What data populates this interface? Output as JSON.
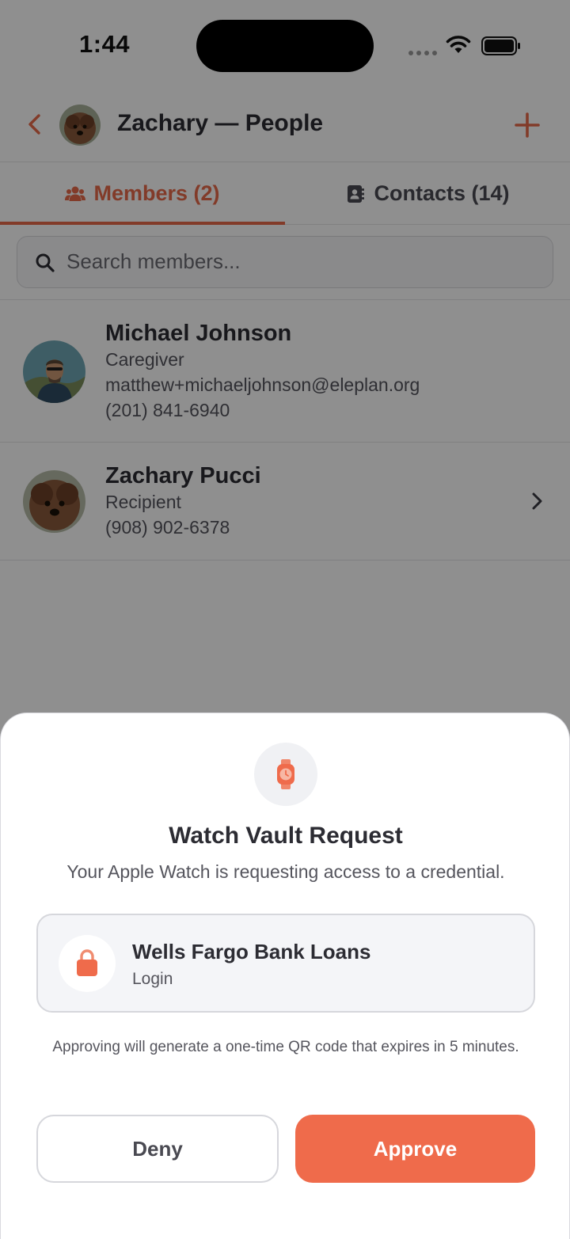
{
  "status_bar": {
    "time": "1:44"
  },
  "nav": {
    "title": "Zachary — People"
  },
  "tabs": [
    {
      "label": "Members (2)",
      "icon": "people-icon",
      "active": true
    },
    {
      "label": "Contacts (14)",
      "icon": "contact-book-icon",
      "active": false
    }
  ],
  "search": {
    "placeholder": "Search members..."
  },
  "members": [
    {
      "name": "Michael Johnson",
      "role": "Caregiver",
      "email": "matthew+michaeljohnson@eleplan.org",
      "phone": "(201) 841-6940"
    },
    {
      "name": "Zachary Pucci",
      "role": "Recipient",
      "phone": "(908) 902-6378"
    }
  ],
  "sheet": {
    "icon": "watch-icon",
    "title": "Watch Vault Request",
    "subtitle": "Your Apple Watch is requesting access to a credential.",
    "credential": {
      "icon": "lock-icon",
      "name": "Wells Fargo Bank Loans",
      "type": "Login"
    },
    "note": "Approving will generate a one-time QR code that expires in 5 minutes.",
    "deny_label": "Deny",
    "approve_label": "Approve"
  },
  "colors": {
    "accent": "#ef6b4b",
    "text": "#2c2c33",
    "muted": "#55555d"
  }
}
